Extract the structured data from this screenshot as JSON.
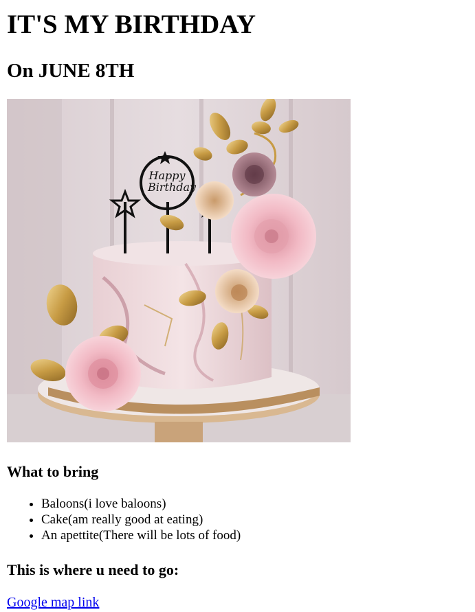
{
  "page": {
    "title": "IT'S MY BIRTHDAY",
    "subtitle": "On JUNE 8TH"
  },
  "image": {
    "topper_text_1": "Happy",
    "topper_text_2": "Birthday"
  },
  "bring": {
    "heading": "What to bring",
    "items": [
      "Baloons(i love baloons)",
      "Cake(am really good at eating)",
      "An apettite(There will be lots of food)"
    ]
  },
  "directions": {
    "heading": "This is where u need to go:",
    "link_label": "Google map link"
  },
  "colors": {
    "link": "#0000ee",
    "text": "#000000",
    "background": "#ffffff"
  }
}
